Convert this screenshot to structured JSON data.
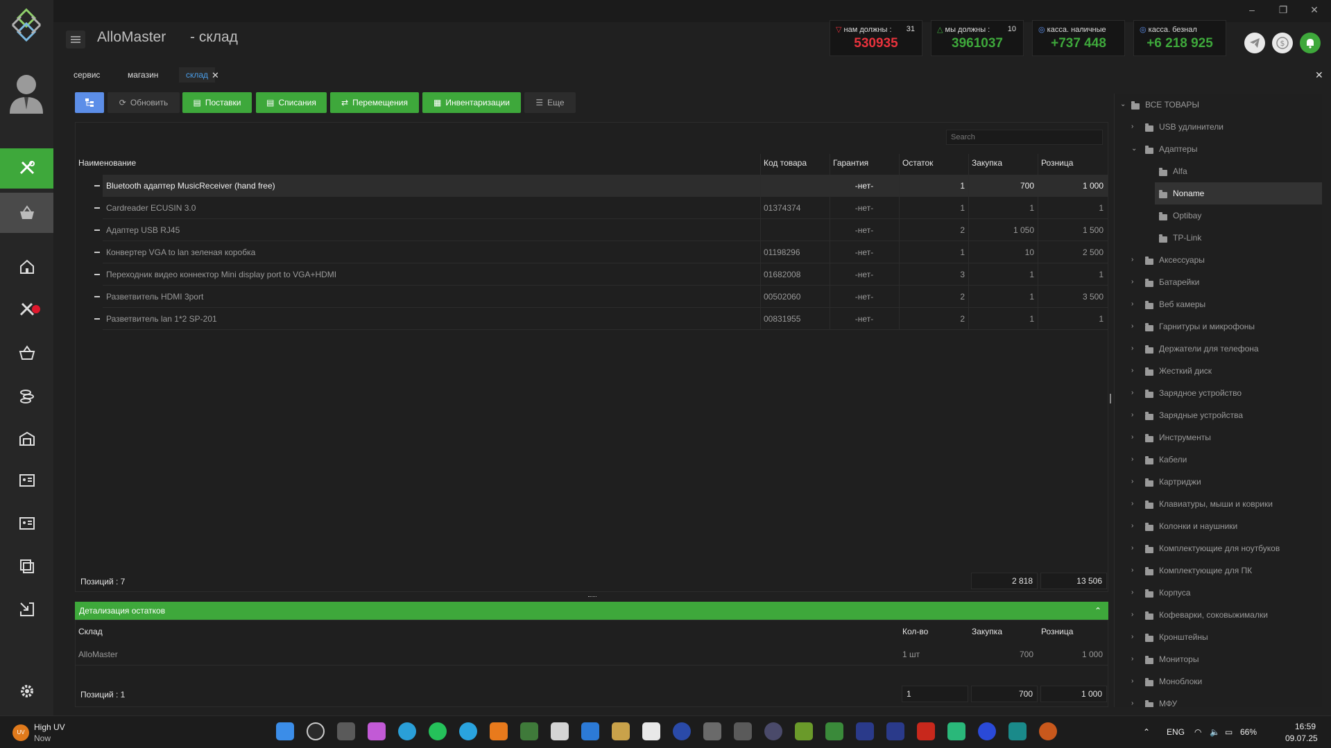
{
  "app": {
    "name": "AlloMaster",
    "section": "- склад"
  },
  "stats": [
    {
      "label": "нам должны :",
      "count": "31",
      "value": "530935",
      "color": "#e8323c"
    },
    {
      "label": "мы должны :",
      "count": "10",
      "value": "3961037",
      "color": "#3ea83b"
    },
    {
      "label": "касса. наличные",
      "count": "",
      "value": "+737 448",
      "color": "#3ea83b"
    },
    {
      "label": "касса. безнал",
      "count": "",
      "value": "+6 218 925",
      "color": "#3ea83b"
    }
  ],
  "tabs": [
    "сервис",
    "магазин",
    "склад"
  ],
  "toolbar": {
    "refresh": "Обновить",
    "supplies": "Поставки",
    "writeoffs": "Списания",
    "moves": "Перемещения",
    "inventory": "Инвентаризации",
    "more": "Еще"
  },
  "search": {
    "placeholder": "Search"
  },
  "table": {
    "headers": [
      "Наименование",
      "Код товара",
      "Гарантия",
      "Остаток",
      "Закупка",
      "Розница"
    ],
    "rows": [
      {
        "name": "Bluetooth адаптер MusicReceiver (hand free)",
        "code": "",
        "warranty": "-нет-",
        "stock": "1",
        "purchase": "700",
        "retail": "1 000"
      },
      {
        "name": "Cardreader ECUSIN 3.0",
        "code": "01374374",
        "warranty": "-нет-",
        "stock": "1",
        "purchase": "1",
        "retail": "1"
      },
      {
        "name": "Адаптер USB RJ45",
        "code": "",
        "warranty": "-нет-",
        "stock": "2",
        "purchase": "1 050",
        "retail": "1 500"
      },
      {
        "name": "Конвертер VGA to lan зеленая коробка",
        "code": "01198296",
        "warranty": "-нет-",
        "stock": "1",
        "purchase": "10",
        "retail": "2 500"
      },
      {
        "name": "Переходник видео коннектор Mini display port to VGA+HDMI",
        "code": "01682008",
        "warranty": "-нет-",
        "stock": "3",
        "purchase": "1",
        "retail": "1"
      },
      {
        "name": "Разветвитель HDMI 3port",
        "code": "00502060",
        "warranty": "-нет-",
        "stock": "2",
        "purchase": "1",
        "retail": "3 500"
      },
      {
        "name": "Разветвитель lan 1*2 SP-201",
        "code": "00831955",
        "warranty": "-нет-",
        "stock": "2",
        "purchase": "1",
        "retail": "1"
      }
    ],
    "footer_label": "Позиций :  7",
    "footer_purchase": "2 818",
    "footer_retail": "13 506"
  },
  "detail": {
    "title": "Детализация остатков",
    "headers": [
      "Склад",
      "Кол-во",
      "Закупка",
      "Розница"
    ],
    "rows": [
      {
        "store": "AlloMaster",
        "qty": "1 шт",
        "purchase": "700",
        "retail": "1 000"
      }
    ],
    "footer_label": "Позиций :  1",
    "footer_qty": "1",
    "footer_purchase": "700",
    "footer_retail": "1 000"
  },
  "tree": {
    "root": "ВСЕ ТОВАРЫ",
    "items": [
      {
        "label": "USB удлинители",
        "level": 1,
        "expanded": false
      },
      {
        "label": "Адаптеры",
        "level": 1,
        "expanded": true
      },
      {
        "label": "Alfa",
        "level": 2
      },
      {
        "label": "Noname",
        "level": 2,
        "selected": true
      },
      {
        "label": "Optibay",
        "level": 2
      },
      {
        "label": "TP-Link",
        "level": 2
      },
      {
        "label": "Аксессуары",
        "level": 1
      },
      {
        "label": "Батарейки",
        "level": 1
      },
      {
        "label": "Веб камеры",
        "level": 1
      },
      {
        "label": "Гарнитуры и микрофоны",
        "level": 1
      },
      {
        "label": "Держатели для телефона",
        "level": 1
      },
      {
        "label": "Жесткий диск",
        "level": 1
      },
      {
        "label": "Зарядное устройство",
        "level": 1
      },
      {
        "label": "Зарядные устройства",
        "level": 1
      },
      {
        "label": "Инструменты",
        "level": 1
      },
      {
        "label": "Кабели",
        "level": 1
      },
      {
        "label": "Картриджи",
        "level": 1
      },
      {
        "label": "Клавиатуры, мыши и коврики",
        "level": 1
      },
      {
        "label": "Колонки и наушники",
        "level": 1
      },
      {
        "label": "Комплектующие для ноутбуков",
        "level": 1
      },
      {
        "label": "Комплектующие для ПК",
        "level": 1
      },
      {
        "label": "Корпуса",
        "level": 1
      },
      {
        "label": "Кофеварки, соковыжималки",
        "level": 1
      },
      {
        "label": "Кронштейны",
        "level": 1
      },
      {
        "label": "Мониторы",
        "level": 1
      },
      {
        "label": "Моноблоки",
        "level": 1
      },
      {
        "label": "МФУ",
        "level": 1
      }
    ]
  },
  "taskbar": {
    "weather_title": "High UV",
    "weather_sub": "Now",
    "weather_badge": "UV",
    "lang": "ENG",
    "battery": "66%",
    "time": "16:59",
    "date": "09.07.25"
  }
}
